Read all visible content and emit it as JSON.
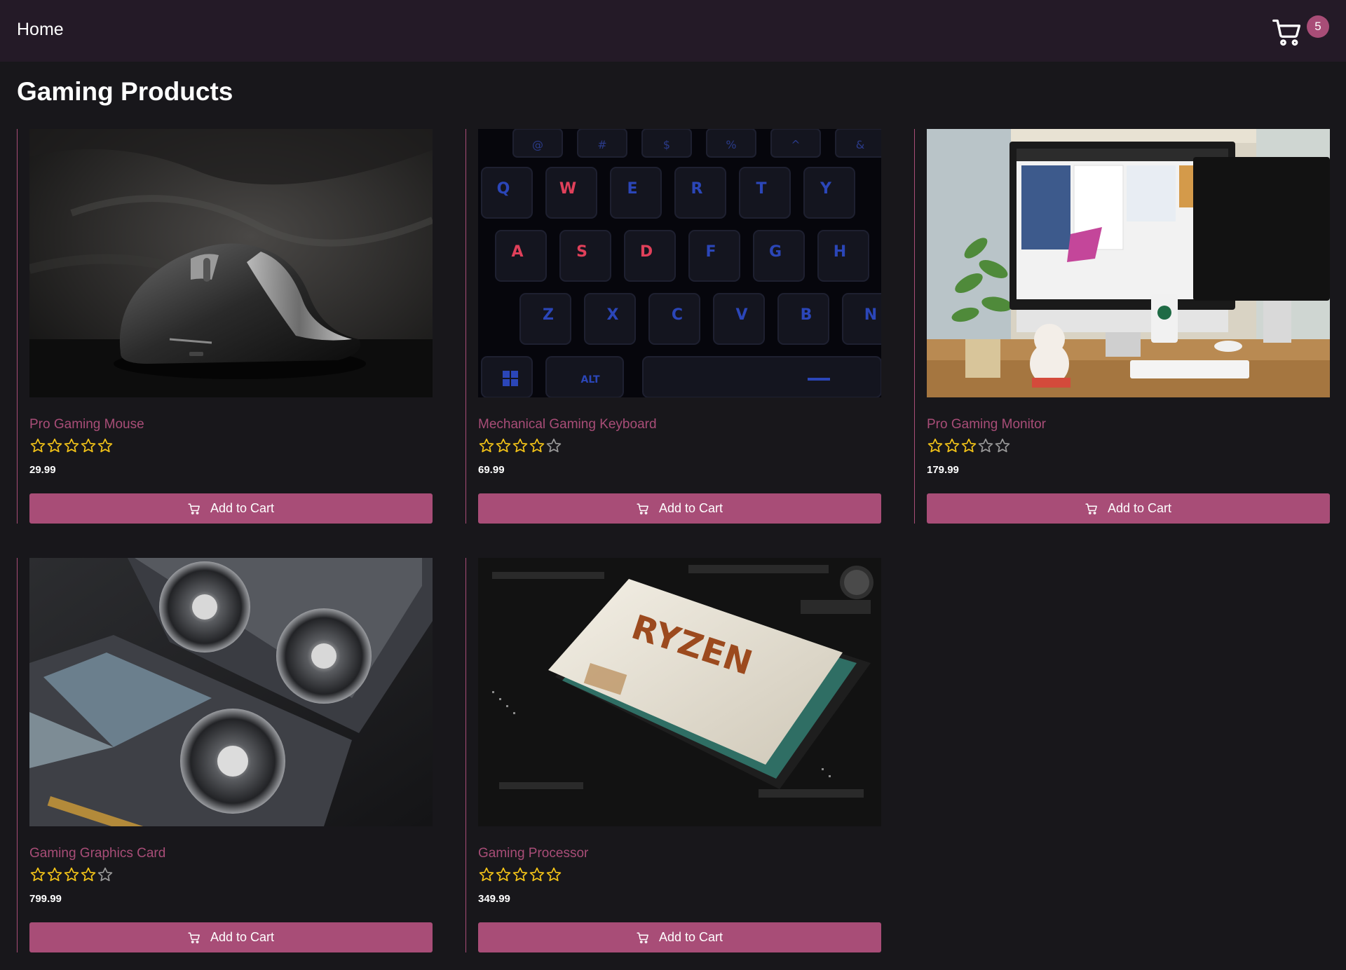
{
  "nav": {
    "home_label": "Home",
    "cart_count": "5",
    "cart_icon": "shopping-cart-icon"
  },
  "page": {
    "title": "Gaming Products"
  },
  "colors": {
    "accent": "#a84d77",
    "navbar_bg": "#241a27",
    "page_bg": "#18171b",
    "star_filled": "#f5c518",
    "star_empty": "#9a9a9a"
  },
  "products": [
    {
      "name": "Pro Gaming Mouse",
      "rating": 5,
      "max_rating": 5,
      "price": "29.99",
      "button_label": "Add to Cart",
      "image": "gaming-mouse-photo"
    },
    {
      "name": "Mechanical Gaming Keyboard",
      "rating": 4,
      "max_rating": 5,
      "price": "69.99",
      "button_label": "Add to Cart",
      "image": "gaming-keyboard-photo"
    },
    {
      "name": "Pro Gaming Monitor",
      "rating": 3,
      "max_rating": 5,
      "price": "179.99",
      "button_label": "Add to Cart",
      "image": "desk-monitor-photo"
    },
    {
      "name": "Gaming Graphics Card",
      "rating": 4,
      "max_rating": 5,
      "price": "799.99",
      "button_label": "Add to Cart",
      "image": "graphics-card-photo"
    },
    {
      "name": "Gaming Processor",
      "rating": 5,
      "max_rating": 5,
      "price": "349.99",
      "button_label": "Add to Cart",
      "image": "processor-photo"
    }
  ]
}
